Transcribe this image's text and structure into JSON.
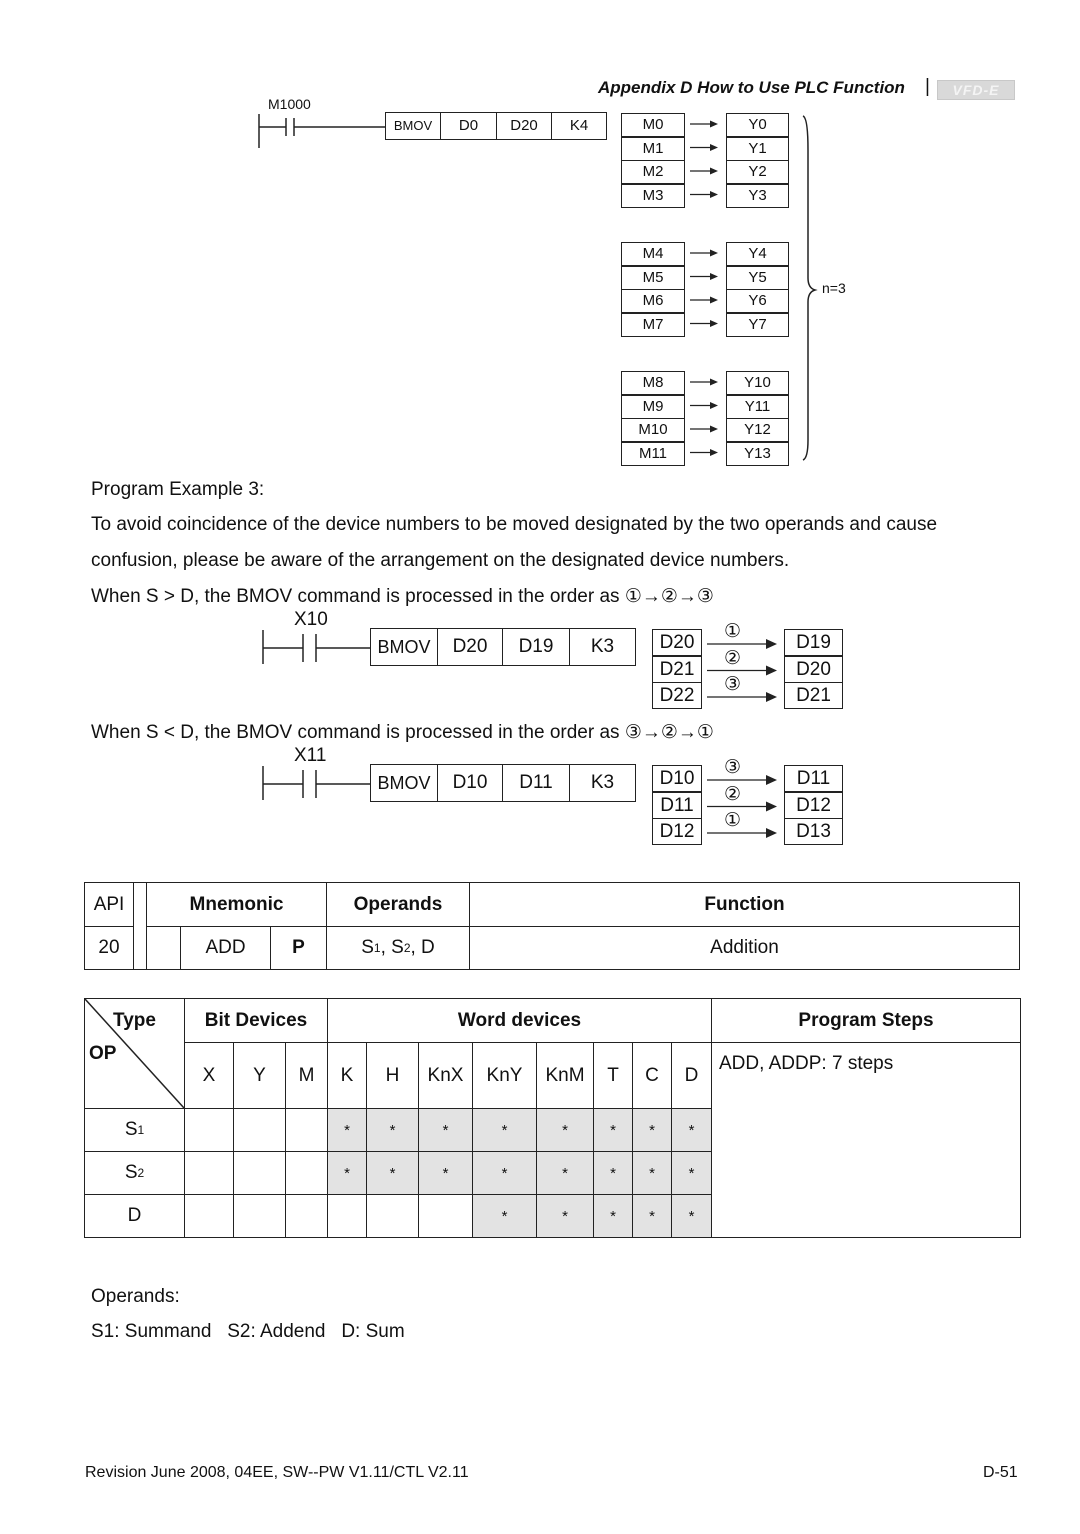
{
  "header": {
    "title": "Appendix D How to Use PLC Function",
    "separator": "|",
    "logo": "VFD-E"
  },
  "diagram1": {
    "contact": "M1000",
    "instruction": [
      "BMOV",
      "D0",
      "D20",
      "K4"
    ],
    "source": [
      "M0",
      "M1",
      "M2",
      "M3",
      "M4",
      "M5",
      "M6",
      "M7",
      "M8",
      "M9",
      "M10",
      "M11"
    ],
    "dest": [
      "Y0",
      "Y1",
      "Y2",
      "Y3",
      "Y4",
      "Y5",
      "Y6",
      "Y7",
      "Y10",
      "Y11",
      "Y12",
      "Y13"
    ],
    "brace_label": "n=3"
  },
  "example": {
    "title": "Program Example 3:",
    "para_line1": "To avoid coincidence of the device numbers to be moved designated by the two operands and cause",
    "para_line2": "confusion, please be aware of the arrangement on the designated device numbers.",
    "case1_text": "When S > D, the BMOV command is processed in the order as ①→②→③",
    "case2_text": "When S < D, the BMOV command is processed in the order as ③→②→①"
  },
  "diagram2": {
    "contact": "X10",
    "instruction": [
      "BMOV",
      "D20",
      "D19",
      "K3"
    ],
    "source": [
      "D20",
      "D21",
      "D22"
    ],
    "dest": [
      "D19",
      "D20",
      "D21"
    ],
    "order": [
      "①",
      "②",
      "③"
    ]
  },
  "diagram3": {
    "contact": "X11",
    "instruction": [
      "BMOV",
      "D10",
      "D11",
      "K3"
    ],
    "source": [
      "D10",
      "D11",
      "D12"
    ],
    "dest": [
      "D11",
      "D12",
      "D13"
    ],
    "order": [
      "③",
      "②",
      "①"
    ]
  },
  "api_table": {
    "headers": {
      "api": "API",
      "mnemonic": "Mnemonic",
      "operands": "Operands",
      "function": "Function"
    },
    "row": {
      "api": "20",
      "mnemonic": "ADD",
      "pulse": "P",
      "operands_s": "S",
      "operands_1": "1",
      "operands_sep": ", S",
      "operands_2": "2",
      "operands_d": ", D",
      "function": "Addition"
    }
  },
  "device_table": {
    "type_label": "Type",
    "op_label": "OP",
    "bit_devices": "Bit Devices",
    "word_devices": "Word devices",
    "program_steps": "Program Steps",
    "program_steps_value": "ADD, ADDP: 7 steps",
    "columns": [
      "X",
      "Y",
      "M",
      "K",
      "H",
      "KnX",
      "KnY",
      "KnM",
      "T",
      "C",
      "D"
    ],
    "rows": [
      {
        "op": "S",
        "sub": "1",
        "marks": [
          "",
          "",
          "",
          "*",
          "*",
          "*",
          "*",
          "*",
          "*",
          "*",
          "*"
        ]
      },
      {
        "op": "S",
        "sub": "2",
        "marks": [
          "",
          "",
          "",
          "*",
          "*",
          "*",
          "*",
          "*",
          "*",
          "*",
          "*"
        ]
      },
      {
        "op": "D",
        "sub": "",
        "marks": [
          "",
          "",
          "",
          "",
          "",
          "",
          "*",
          "*",
          "*",
          "*",
          "*"
        ]
      }
    ]
  },
  "operands_note": {
    "title": "Operands:",
    "line": "S1: Summand   S2: Addend   D: Sum"
  },
  "footer": {
    "revision": "Revision June 2008, 04EE, SW--PW V1.11/CTL V2.11",
    "page": "D-51"
  }
}
